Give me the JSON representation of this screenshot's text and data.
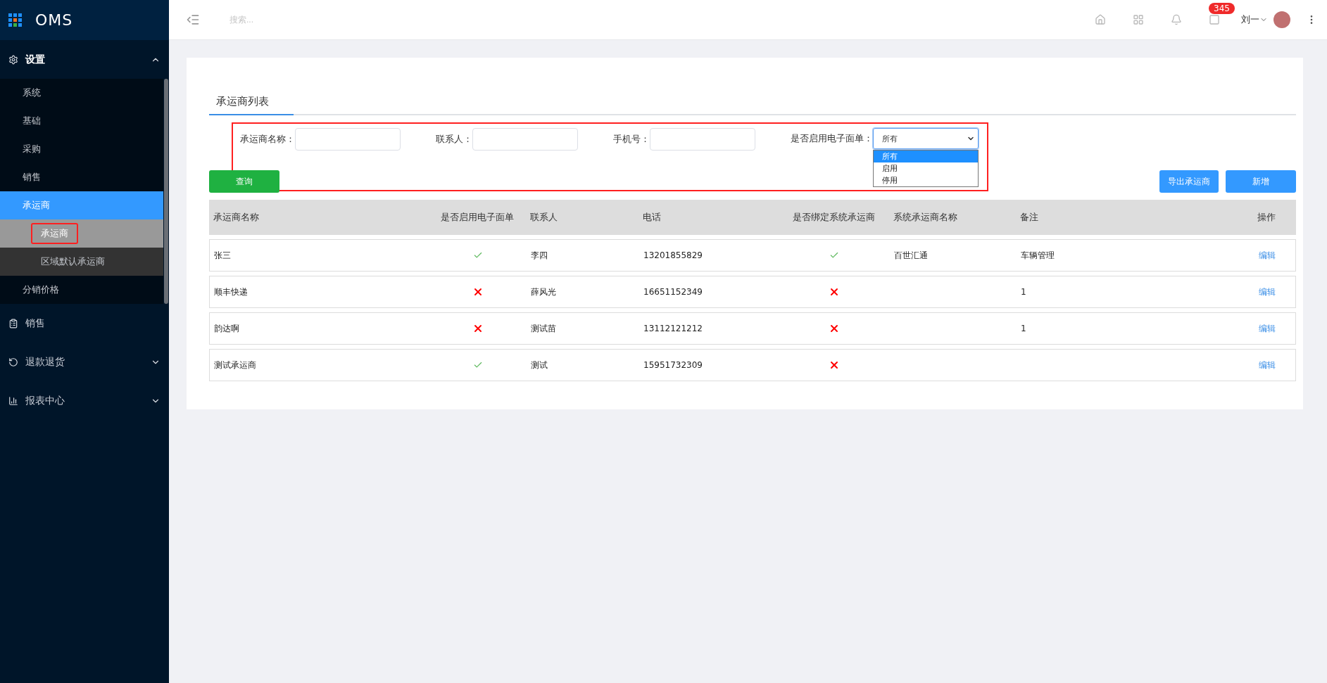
{
  "app": {
    "logo": "OMS"
  },
  "sidebar": {
    "items": [
      {
        "label": "设置",
        "expanded": true,
        "children": [
          {
            "label": "系统",
            "selected": false
          },
          {
            "label": "基础",
            "selected": false
          },
          {
            "label": "采购",
            "selected": false
          },
          {
            "label": "销售",
            "selected": false
          },
          {
            "label": "承运商",
            "selected": true,
            "children": [
              {
                "label": "承运商",
                "selected": true,
                "highlighted": true
              },
              {
                "label": "区域默认承运商",
                "selected": false,
                "highlighted": false
              }
            ]
          },
          {
            "label": "分销价格",
            "selected": false
          }
        ]
      },
      {
        "label": "销售",
        "expanded": false
      },
      {
        "label": "退款退货",
        "expanded": false,
        "has_children": true
      },
      {
        "label": "报表中心",
        "expanded": false,
        "has_children": true
      }
    ]
  },
  "header": {
    "search_placeholder": "搜索...",
    "badge": "345",
    "user": "刘一"
  },
  "tabs": [
    {
      "label": "承运商列表",
      "selected": true
    }
  ],
  "filters": {
    "highlighted": true,
    "fields": [
      {
        "kind": "input",
        "label": "承运商名称："
      },
      {
        "kind": "input",
        "label": "联系人："
      },
      {
        "kind": "input",
        "label": "手机号："
      },
      {
        "kind": "select",
        "label": "是否启用电子面单：",
        "value": "所有",
        "expanded": true,
        "options": [
          {
            "label": "所有",
            "selected": true
          },
          {
            "label": "启用",
            "selected": false
          },
          {
            "label": "停用",
            "selected": false
          }
        ]
      }
    ]
  },
  "buttons": {
    "query": "查询",
    "export": "导出承运商",
    "add": "新增"
  },
  "table": {
    "columns": [
      "承运商名称",
      "是否启用电子面单",
      "联系人",
      "电话",
      "是否绑定系统承运商",
      "系统承运商名称",
      "备注",
      "操作"
    ],
    "rows": [
      {
        "name": "张三",
        "e_waybill": true,
        "contact": "李四",
        "phone": "13201855829",
        "bound": true,
        "system_carrier": "百世汇通",
        "remark": "车辆管理",
        "action": "编辑"
      },
      {
        "name": "顺丰快递",
        "e_waybill": false,
        "contact": "薛风光",
        "phone": "16651152349",
        "bound": false,
        "remark": "1",
        "action": "编辑"
      },
      {
        "name": "韵达啊",
        "e_waybill": false,
        "contact": "测试苗",
        "phone": "13112121212",
        "bound": false,
        "remark": "1",
        "action": "编辑"
      },
      {
        "name": "测试承运商",
        "e_waybill": true,
        "contact": "测试",
        "phone": "15951732309",
        "bound": false,
        "action": "编辑"
      }
    ]
  }
}
